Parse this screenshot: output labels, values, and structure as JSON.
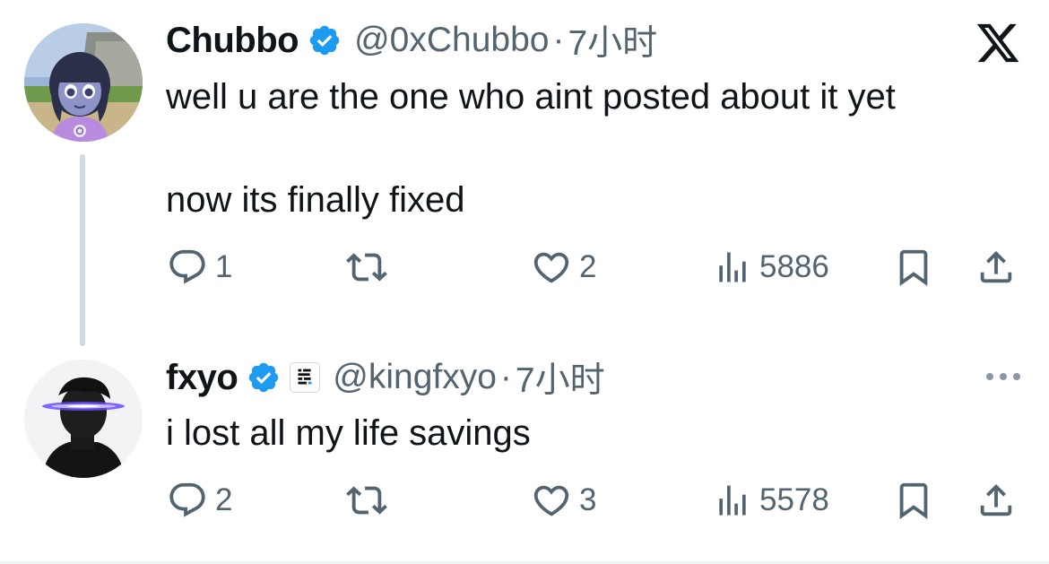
{
  "theme": {
    "accent": "#1d9bf0",
    "text_primary": "#0f1419",
    "text_secondary": "#536471",
    "thread_line": "#cfd9de"
  },
  "tweets": [
    {
      "name": "Chubbo",
      "handle": "@0xChubbo",
      "separator": "·",
      "time": "7小时",
      "verified": true,
      "lines": [
        "well u are the one who aint posted about it yet",
        "now its finally fixed"
      ],
      "reply_count": "1",
      "retweet_count": "",
      "like_count": "2",
      "view_count": "5886",
      "icons": [
        "reply-icon",
        "retweet-icon",
        "like-icon",
        "views-icon",
        "bookmark-icon",
        "share-icon"
      ]
    },
    {
      "name": "fxyo",
      "handle": "@kingfxyo",
      "separator": "·",
      "time": "7小时",
      "verified": true,
      "lines": [
        "i lost all my life savings"
      ],
      "reply_count": "2",
      "retweet_count": "",
      "like_count": "3",
      "view_count": "5578",
      "icons": [
        "reply-icon",
        "retweet-icon",
        "like-icon",
        "views-icon",
        "bookmark-icon",
        "share-icon"
      ]
    }
  ],
  "header_icons": [
    "x-logo-icon",
    "more-options-icon"
  ]
}
